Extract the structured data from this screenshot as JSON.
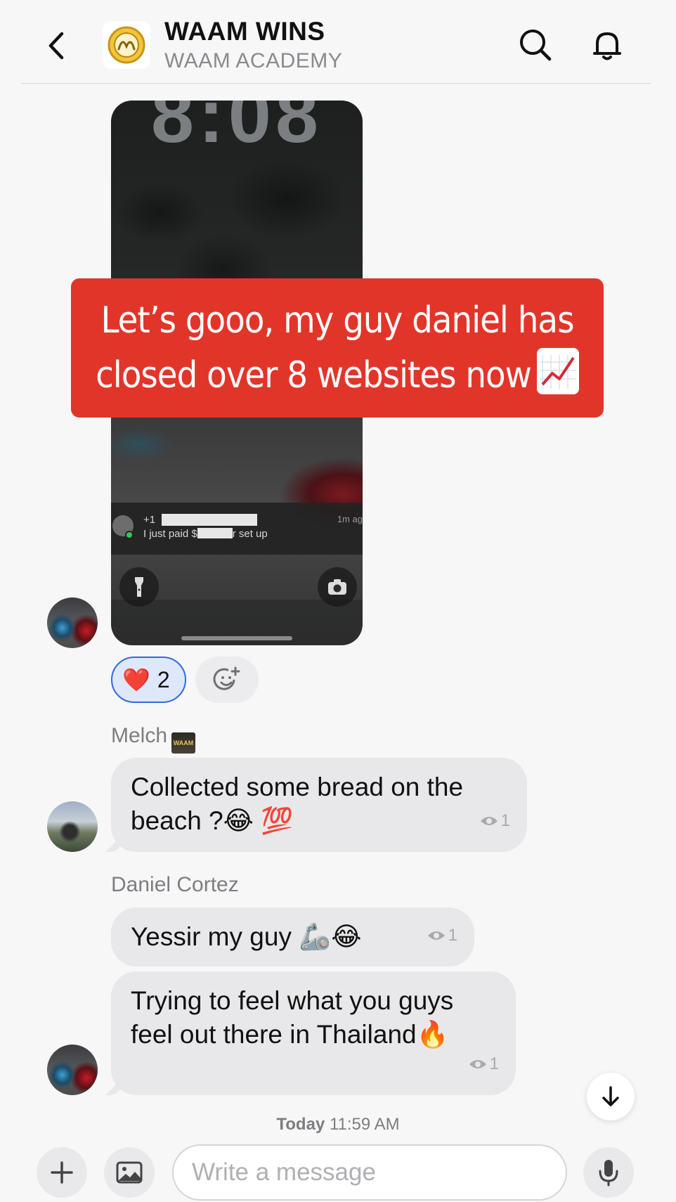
{
  "header": {
    "title": "WAAM WINS",
    "subtitle": "WAAM ACADEMY"
  },
  "image_message": {
    "clock": "8:08",
    "notification": {
      "line1_prefix": "+1",
      "line2_prefix": "I just paid $",
      "line2_suffix": "r set up",
      "time": "1m ag"
    },
    "banner_text_line1": "Let’s gooo, my guy daniel has",
    "banner_text_line2": "closed over 8 websites now",
    "reactions": [
      {
        "emoji": "❤️",
        "count": "2"
      }
    ]
  },
  "messages": [
    {
      "sender": "Melch",
      "text": "Collected some bread on the beach ?😂 💯",
      "seen_count": "1"
    },
    {
      "sender": "Daniel Cortez",
      "text": "Yessir my guy 🦾😂",
      "seen_count": "1"
    },
    {
      "sender": "Daniel Cortez",
      "text": "Trying to feel what you guys feel out there in Thailand🔥",
      "seen_count": "1"
    }
  ],
  "timestamp": {
    "day": "Today",
    "time": "11:59 AM"
  },
  "badge_text": "WAAM",
  "composer": {
    "placeholder": "Write a message"
  }
}
